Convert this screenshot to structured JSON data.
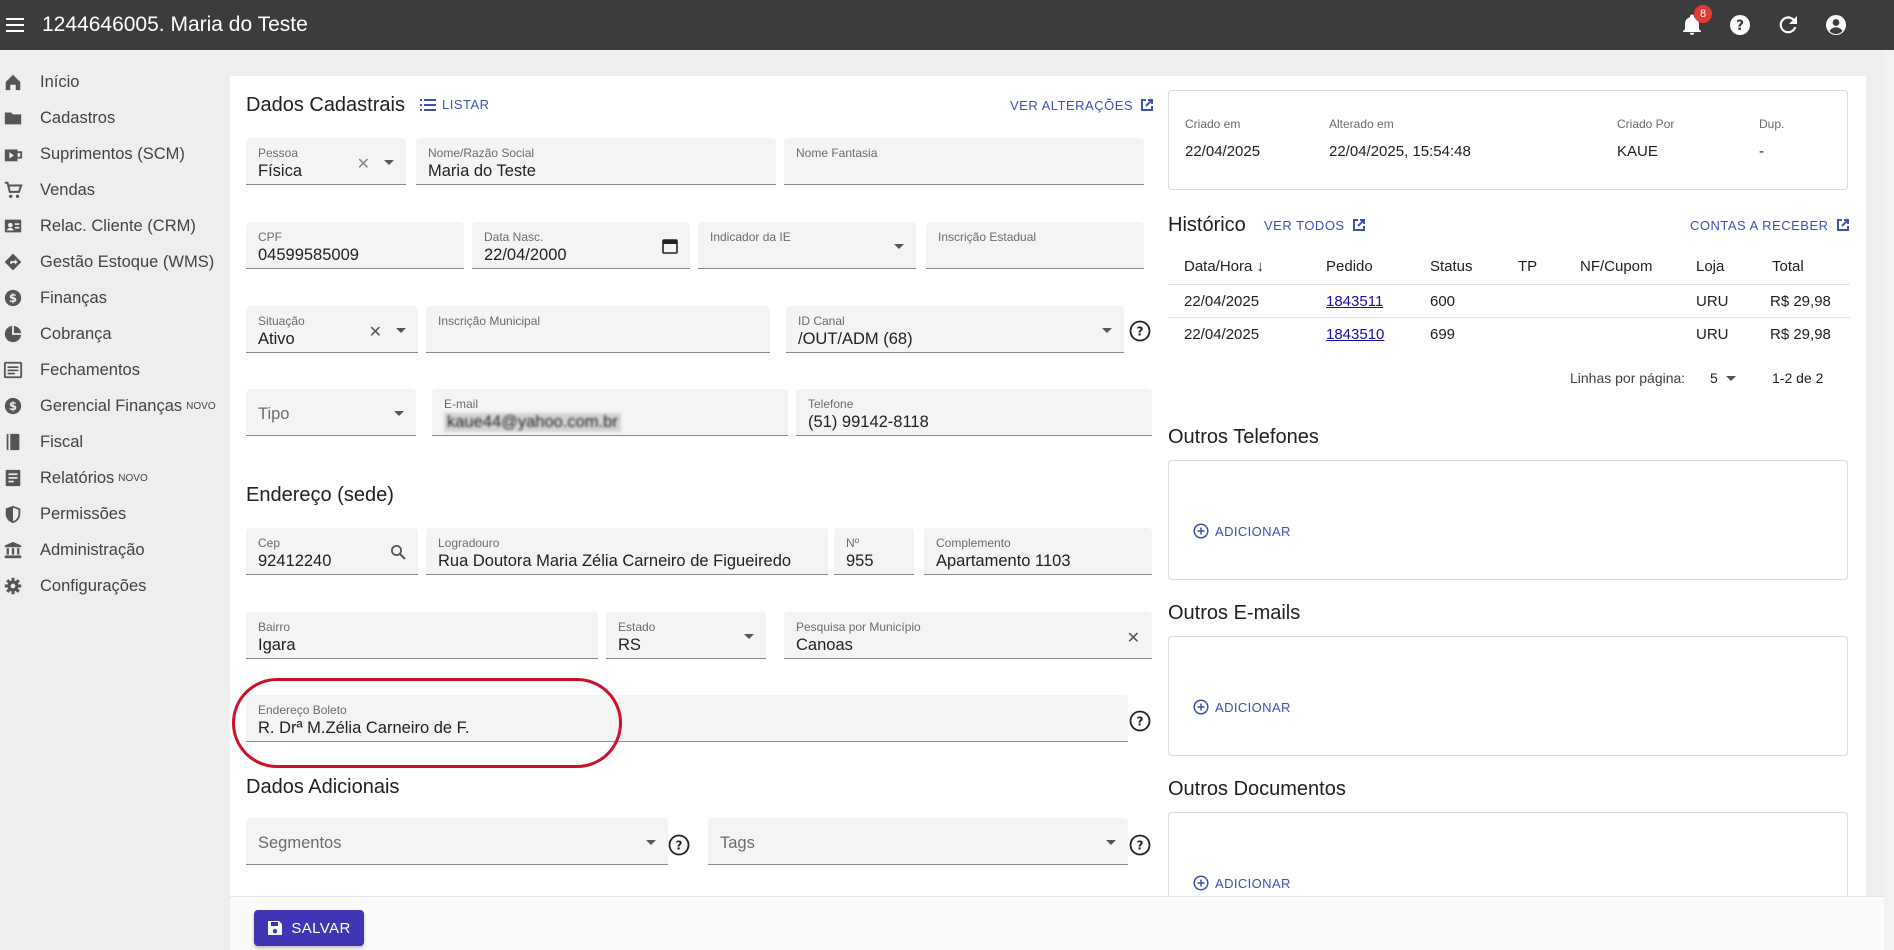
{
  "header": {
    "title": "1244646005. Maria do Teste",
    "notifications": "8"
  },
  "sidebar": {
    "items": [
      {
        "label": "Início",
        "icon": "home-icon"
      },
      {
        "label": "Cadastros",
        "icon": "folder-icon"
      },
      {
        "label": "Suprimentos (SCM)",
        "icon": "supply-icon"
      },
      {
        "label": "Vendas",
        "icon": "cart-icon"
      },
      {
        "label": "Relac. Cliente (CRM)",
        "icon": "contact-card-icon"
      },
      {
        "label": "Gestão Estoque (WMS)",
        "icon": "directions-icon"
      },
      {
        "label": "Finanças",
        "icon": "dollar-icon"
      },
      {
        "label": "Cobrança",
        "icon": "pie-icon"
      },
      {
        "label": "Fechamentos",
        "icon": "list-box-icon"
      },
      {
        "label": "Gerencial Finanças",
        "icon": "dollar-icon",
        "tag": "NOVO"
      },
      {
        "label": "Fiscal",
        "icon": "book-icon"
      },
      {
        "label": "Relatórios",
        "icon": "report-icon",
        "tag": "NOVO"
      },
      {
        "label": "Permissões",
        "icon": "shield-icon"
      },
      {
        "label": "Administração",
        "icon": "bank-icon"
      },
      {
        "label": "Configurações",
        "icon": "gear-icon"
      }
    ]
  },
  "dados": {
    "title": "Dados Cadastrais",
    "listar": "LISTAR",
    "ver_alteracoes": "VER ALTERAÇÕES",
    "pessoa": {
      "label": "Pessoa",
      "value": "Física"
    },
    "nome": {
      "label": "Nome/Razão Social",
      "value": "Maria do Teste"
    },
    "fantasia": {
      "label": "Nome Fantasia",
      "value": ""
    },
    "cpf": {
      "label": "CPF",
      "value": "04599585009"
    },
    "nasc": {
      "label": "Data Nasc.",
      "value": "22/04/2000"
    },
    "ie_ind": {
      "label": "Indicador da IE",
      "value": ""
    },
    "ie": {
      "label": "Inscrição Estadual",
      "value": ""
    },
    "situacao": {
      "label": "Situação",
      "value": "Ativo"
    },
    "im": {
      "label": "Inscrição Municipal",
      "value": ""
    },
    "canal": {
      "label": "ID Canal",
      "value": "/OUT/ADM (68)"
    },
    "tipo": {
      "placeholder": "Tipo"
    },
    "email": {
      "label": "E-mail",
      "value": "kaue44@yahoo.com.br"
    },
    "telefone": {
      "label": "Telefone",
      "value": "(51) 99142-8118"
    }
  },
  "endereco": {
    "title": "Endereço (sede)",
    "cep": {
      "label": "Cep",
      "value": "92412240"
    },
    "logradouro": {
      "label": "Logradouro",
      "value": "Rua Doutora Maria Zélia Carneiro de Figueiredo"
    },
    "numero": {
      "label": "Nº",
      "value": "955"
    },
    "complemento": {
      "label": "Complemento",
      "value": "Apartamento 1103"
    },
    "bairro": {
      "label": "Bairro",
      "value": "Igara"
    },
    "estado": {
      "label": "Estado",
      "value": "RS"
    },
    "municipio": {
      "label": "Pesquisa por Município",
      "value": "Canoas"
    },
    "boleto": {
      "label": "Endereço Boleto",
      "value": "R. Drª M.Zélia Carneiro de F."
    }
  },
  "adicionais": {
    "title": "Dados Adicionais",
    "segmentos": {
      "placeholder": "Segmentos"
    },
    "tags": {
      "placeholder": "Tags"
    }
  },
  "meta": {
    "criado_em": {
      "label": "Criado em",
      "value": "22/04/2025"
    },
    "alterado_em": {
      "label": "Alterado em",
      "value": "22/04/2025, 15:54:48"
    },
    "criado_por": {
      "label": "Criado Por",
      "value": "KAUE"
    },
    "dup": {
      "label": "Dup.",
      "value": "-"
    }
  },
  "historico": {
    "title": "Histórico",
    "ver_todos": "VER TODOS",
    "contas": "CONTAS A RECEBER",
    "columns": [
      "Data/Hora",
      "Pedido",
      "Status",
      "TP",
      "NF/Cupom",
      "Loja",
      "Total"
    ],
    "rows": [
      {
        "data": "22/04/2025",
        "pedido": "1843511",
        "status": "600",
        "tp": "",
        "nf": "",
        "loja": "URU",
        "total": "R$ 29,98"
      },
      {
        "data": "22/04/2025",
        "pedido": "1843510",
        "status": "699",
        "tp": "",
        "nf": "",
        "loja": "URU",
        "total": "R$ 29,98"
      }
    ],
    "rows_label": "Linhas por página:",
    "rows_value": "5",
    "range": "1-2 de 2"
  },
  "outros": {
    "telefones": "Outros Telefones",
    "emails": "Outros E-mails",
    "documentos": "Outros Documentos",
    "adicionar": "ADICIONAR"
  },
  "save": "SALVAR",
  "colors": {
    "accent": "#3f51b5",
    "save": "#3f35b5",
    "topbar": "#3c3c3c",
    "highlight": "#d0102a"
  }
}
